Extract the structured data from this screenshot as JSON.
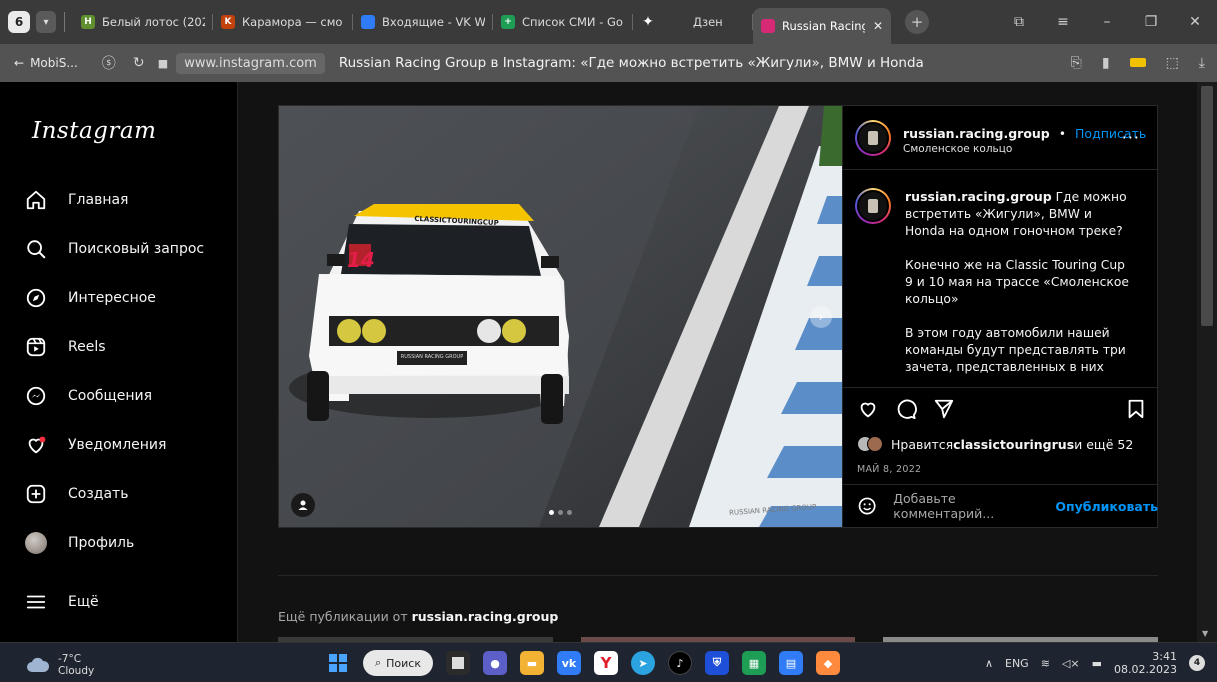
{
  "browser": {
    "tab_count": "6",
    "tabs": [
      {
        "label": "Белый лотос (202",
        "favicon_color": "#5f8f2f",
        "favicon_text": "H"
      },
      {
        "label": "Карамора — смо",
        "favicon_color": "#c2410c",
        "favicon_text": "K"
      },
      {
        "label": "Входящие - VK W",
        "favicon_color": "#2f7cf6",
        "favicon_text": ""
      },
      {
        "label": "Список СМИ - Go",
        "favicon_color": "#1e9e55",
        "favicon_text": "+"
      },
      {
        "label": "Дзен",
        "favicon_color": "#000000",
        "favicon_text": "✦"
      },
      {
        "label": "Russian Racing",
        "favicon_color": "#d62976",
        "favicon_text": "",
        "active": true
      }
    ],
    "back_label": "MobiS...",
    "url": "www.instagram.com",
    "page_title": "Russian Racing Group в Instagram: «Где можно встретить «Жигули», BMW и Honda на..."
  },
  "sidebar": {
    "logo": "Instagram",
    "items": [
      {
        "label": "Главная",
        "icon": "home-icon"
      },
      {
        "label": "Поисковый запрос",
        "icon": "search-icon"
      },
      {
        "label": "Интересное",
        "icon": "explore-icon"
      },
      {
        "label": "Reels",
        "icon": "reels-icon"
      },
      {
        "label": "Сообщения",
        "icon": "messenger-icon"
      },
      {
        "label": "Уведомления",
        "icon": "heart-icon"
      },
      {
        "label": "Создать",
        "icon": "plus-square-icon"
      },
      {
        "label": "Профиль",
        "icon": "avatar"
      },
      {
        "label": "Ещё",
        "icon": "hamburger-icon"
      }
    ]
  },
  "post": {
    "username": "russian.racing.group",
    "separator": "•",
    "follow_label": "Подписать",
    "location": "Смоленское кольцо",
    "caption_username": "russian.racing.group",
    "caption_paragraphs": [
      "Где можно встретить «Жигули», BMW и Honda на одном гоночном треке?",
      "Конечно же на Classic Touring Cup 9 и 10 мая на трассе «Смоленское кольцо»",
      "В этом году автомобили нашей команды будут представлять три",
      "зачета, представленных в них"
    ],
    "likes_prefix": "Нравится ",
    "likes_user": "classictouringrus",
    "likes_suffix": " и ещё 52",
    "date": "МАЙ 8, 2022",
    "comment_placeholder": "Добавьте комментарий...",
    "publish_label": "Опубликовать",
    "photo": {
      "windshield_text": "CLASSICTOURINGCUP",
      "car_number": "14",
      "plate_text": "RUSSIAN RACING GROUP",
      "watermark": "RUSSIAN RACING GROUP"
    }
  },
  "more_posts": {
    "prefix": "Ещё публикации от ",
    "username": "russian.racing.group"
  },
  "taskbar": {
    "temperature": "-7°C",
    "condition": "Cloudy",
    "search_label": "Поиск",
    "lang": "ENG",
    "time": "3:41",
    "date": "08.02.2023",
    "notifications": "4"
  }
}
